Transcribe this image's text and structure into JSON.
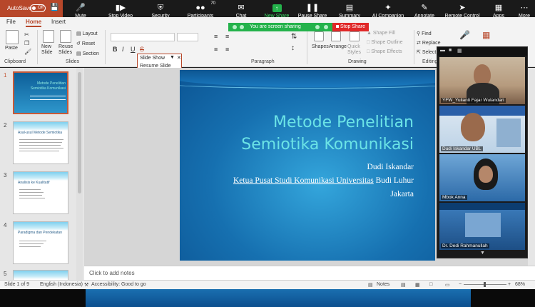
{
  "titlebar": {
    "autosave_label": "AutoSave",
    "autosave_state": "Off"
  },
  "zoom_toolbar": {
    "buttons": [
      {
        "label": "Mute",
        "icon": "microphone-icon"
      },
      {
        "label": "Stop Video",
        "icon": "video-camera-icon"
      },
      {
        "label": "Security",
        "icon": "shield-icon"
      },
      {
        "label": "Participants",
        "icon": "people-icon",
        "count": "70"
      },
      {
        "label": "Chat",
        "icon": "chat-bubble-icon"
      },
      {
        "label": "New Share",
        "icon": "share-screen-icon"
      },
      {
        "label": "Pause Share",
        "icon": "pause-icon"
      },
      {
        "label": "Summary",
        "icon": "document-icon"
      },
      {
        "label": "AI Companion",
        "icon": "sparkle-icon"
      },
      {
        "label": "Annotate",
        "icon": "pen-icon"
      },
      {
        "label": "Remote Control",
        "icon": "cursor-icon"
      },
      {
        "label": "Apps",
        "icon": "grid-icon"
      },
      {
        "label": "More",
        "icon": "more-dots-icon"
      }
    ],
    "accent_green": "#24b24b"
  },
  "share_banner": {
    "text": "You are screen sharing",
    "stop_label": "Stop Share",
    "stop_color": "#e02828"
  },
  "ribbon": {
    "tabs": [
      "File",
      "Home",
      "Insert"
    ],
    "active_tab": "Home",
    "clipboard": {
      "paste": "Paste",
      "group": "Clipboard"
    },
    "slides": {
      "new_slide": "New Slide",
      "reuse_slides": "Reuse Slides",
      "layout": "Layout",
      "reset": "Reset",
      "section": "Section",
      "group": "Slides"
    },
    "font_buttons": [
      "B",
      "I",
      "U",
      "S"
    ],
    "paragraph_group": "Paragraph",
    "drawing": {
      "shapes": "Shapes",
      "arrange": "Arrange",
      "quick_styles": "Quick Styles",
      "shape_fill": "Shape Fill",
      "shape_outline": "Shape Outline",
      "shape_effects": "Shape Effects",
      "group": "Drawing"
    },
    "editing": {
      "find": "Find",
      "replace": "Replace",
      "select": "Select",
      "group": "Editing"
    }
  },
  "slideshow_menu": {
    "items": [
      "Slide Show",
      "Resume Slide Show"
    ]
  },
  "thumbnails": [
    {
      "num": "1",
      "title": "Metode Penelitian Semiotika Komunikasi"
    },
    {
      "num": "2",
      "title": "Asal-usul Metode Semiotika"
    },
    {
      "num": "3",
      "title": "Analisis ke Kualitatif"
    },
    {
      "num": "4",
      "title": "Paradigma dan Pendekatan"
    },
    {
      "num": "5",
      "title": ""
    }
  ],
  "slide": {
    "title_line1": "Metode Penelitian",
    "title_line2": "Semiotika Komunikasi",
    "author": "Dudi Iskandar",
    "affiliation_underlined": "Ketua Pusat Studi Komunikasi Universitas",
    "affiliation_rest": " Budi Luhur",
    "city": "Jakarta"
  },
  "notes_placeholder": "Click to add notes",
  "statusbar": {
    "slide_info": "Slide 1 of 9",
    "language": "English (Indonesia)",
    "accessibility": "Accessibility: Good to go",
    "notes": "Notes",
    "zoom": "68%"
  },
  "video_panel": {
    "participants": [
      {
        "name": "YFW_Yulianti Fajar Wulandari"
      },
      {
        "name": "Dudi Iskandar UBL"
      },
      {
        "name": "Mbok Anna"
      },
      {
        "name": "Dr. Dedi Rahmanullah"
      }
    ]
  }
}
